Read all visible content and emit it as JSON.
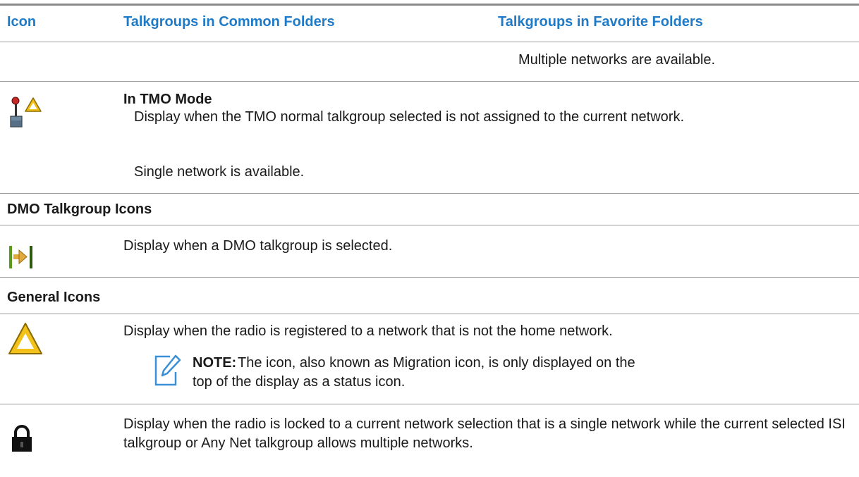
{
  "table": {
    "headers": {
      "icon": "Icon",
      "common": "Talkgroups in Common Folders",
      "favorite": "Talkgroups in Favorite Folders"
    },
    "row_multiple": {
      "text": "Multiple networks are available."
    },
    "row_tmo": {
      "icon": "tmo-talkgroup-warning-icon",
      "heading": "In TMO Mode",
      "text": "Display when the TMO normal talkgroup selected is not assigned to the current network.",
      "note": "Single network is available."
    },
    "section_dmo": {
      "title": "DMO Talkgroup Icons",
      "row": {
        "icon": "dmo-talkgroup-icon",
        "text": "Display when a DMO talkgroup is selected."
      }
    },
    "section_general": {
      "title": "General Icons",
      "row_migration": {
        "icon": "migration-triangle-icon",
        "text": "Display when the radio is registered to a network that is not the home network.",
        "note_label": "NOTE:",
        "note_text": "The icon, also known as Migration icon, is only displayed on the top of the display as a status icon."
      },
      "row_lock": {
        "icon": "lock-icon",
        "text": "Display when the radio is locked to a current network selection that is a single network while the current selected ISI talkgroup or Any Net talkgroup allows multiple networks."
      }
    }
  },
  "colors": {
    "header_text": "#1f7ac7",
    "note_icon": "#3a8fd6",
    "rule": "#9a9a9a",
    "warning_fill": "#f2c21b",
    "warning_stroke": "#8a6a00",
    "dmo_green": "#5a9a1a"
  }
}
